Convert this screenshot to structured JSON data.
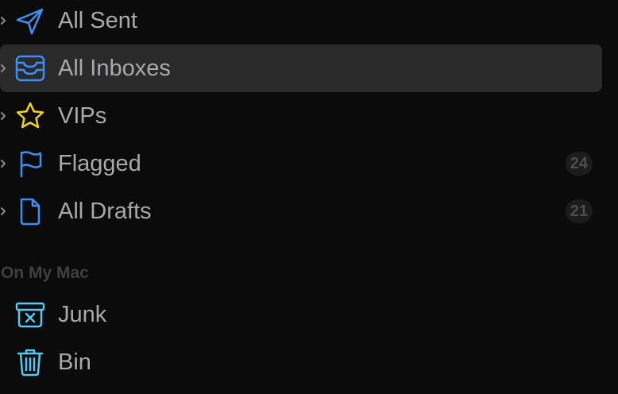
{
  "sidebar": {
    "favorites": [
      {
        "label": "All Sent",
        "icon": "paper-plane-icon",
        "badge": ""
      },
      {
        "label": "All Inboxes",
        "icon": "inbox-tray-icon",
        "badge": ""
      },
      {
        "label": "VIPs",
        "icon": "star-icon",
        "badge": ""
      },
      {
        "label": "Flagged",
        "icon": "flag-icon",
        "badge": "24"
      },
      {
        "label": "All Drafts",
        "icon": "document-icon",
        "badge": "21"
      }
    ],
    "section_header": "On My Mac",
    "local": [
      {
        "label": "Junk",
        "icon": "junk-box-icon"
      },
      {
        "label": "Bin",
        "icon": "trash-icon"
      }
    ]
  },
  "colors": {
    "accent_blue": "#3d8ef5",
    "junk_cyan": "#59c8f0",
    "vip_yellow": "#f5d60a",
    "selected_row": "#2a2a2b",
    "background": "#0b0b0b"
  }
}
